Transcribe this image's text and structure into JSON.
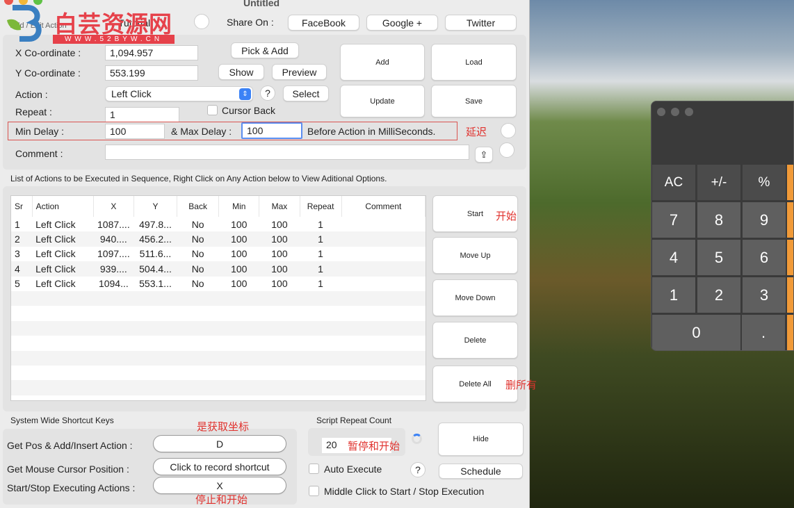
{
  "window": {
    "title": "Untitled",
    "tab_label": "Add / Edit Action",
    "tutorial": "Tutorial"
  },
  "watermark": {
    "text": "白芸资源网",
    "url": "WWW.52BYW.CN"
  },
  "share": {
    "label": "Share On :",
    "buttons": [
      "FaceBook",
      "Google +",
      "Twitter"
    ]
  },
  "form": {
    "x_label": "X Co-ordinate :",
    "x_value": "1,094.957",
    "y_label": "Y Co-ordinate :",
    "y_value": "553.199",
    "pick_add": "Pick & Add",
    "show": "Show",
    "preview": "Preview",
    "action_label": "Action :",
    "action_value": "Left Click",
    "help": "?",
    "select": "Select",
    "repeat_label": "Repeat :",
    "repeat_value": "1",
    "cursor_back": "Cursor Back",
    "min_delay_label": "Min Delay :",
    "min_delay": "100",
    "max_delay_label": "& Max Delay :",
    "max_delay": "100",
    "delay_suffix": "Before Action in MilliSeconds.",
    "comment_label": "Comment :",
    "comment_value": ""
  },
  "actions": {
    "add": "Add",
    "load": "Load",
    "update": "Update",
    "save": "Save"
  },
  "list": {
    "caption": "List of Actions to be Executed in Sequence, Right Click on Any Action below to View Aditional Options.",
    "columns": [
      "Sr",
      "Action",
      "X",
      "Y",
      "Back",
      "Min",
      "Max",
      "Repeat",
      "Comment"
    ],
    "rows": [
      [
        "1",
        "Left Click",
        "1087....",
        "497.8...",
        "No",
        "100",
        "100",
        "1",
        ""
      ],
      [
        "2",
        "Left Click",
        "940....",
        "456.2...",
        "No",
        "100",
        "100",
        "1",
        ""
      ],
      [
        "3",
        "Left Click",
        "1097....",
        "511.6...",
        "No",
        "100",
        "100",
        "1",
        ""
      ],
      [
        "4",
        "Left Click",
        "939....",
        "504.4...",
        "No",
        "100",
        "100",
        "1",
        ""
      ],
      [
        "5",
        "Left Click",
        "1094...",
        "553.1...",
        "No",
        "100",
        "100",
        "1",
        ""
      ]
    ]
  },
  "side_buttons": [
    "Start",
    "Move Up",
    "Move Down",
    "Delete",
    "Delete All"
  ],
  "shortcuts": {
    "title": "System Wide Shortcut Keys",
    "rows": [
      {
        "label": "Get Pos & Add/Insert Action :",
        "value": "D"
      },
      {
        "label": "Get Mouse Cursor Position :",
        "value": "Click to record shortcut"
      },
      {
        "label": "Start/Stop Executing Actions :",
        "value": "X"
      }
    ]
  },
  "script": {
    "title": "Script Repeat Count",
    "count": "20",
    "hide": "Hide",
    "auto_execute": "Auto Execute",
    "help": "?",
    "schedule": "Schedule",
    "middle_click": "Middle Click to Start / Stop Execution"
  },
  "annotations": {
    "delay": "延迟",
    "start": "开始",
    "delete_all": "删所有",
    "get_coord": "是获取坐标",
    "pause": "暂停和开始",
    "stop": "停止和开始"
  },
  "calculator": {
    "keys": [
      [
        "AC",
        "+/-",
        "%"
      ],
      [
        "7",
        "8",
        "9"
      ],
      [
        "4",
        "5",
        "6"
      ],
      [
        "1",
        "2",
        "3"
      ],
      [
        "0",
        "."
      ]
    ]
  },
  "colors": {
    "annotation": "#e0322e",
    "accent": "#f19a38",
    "focus": "#5b8def"
  }
}
